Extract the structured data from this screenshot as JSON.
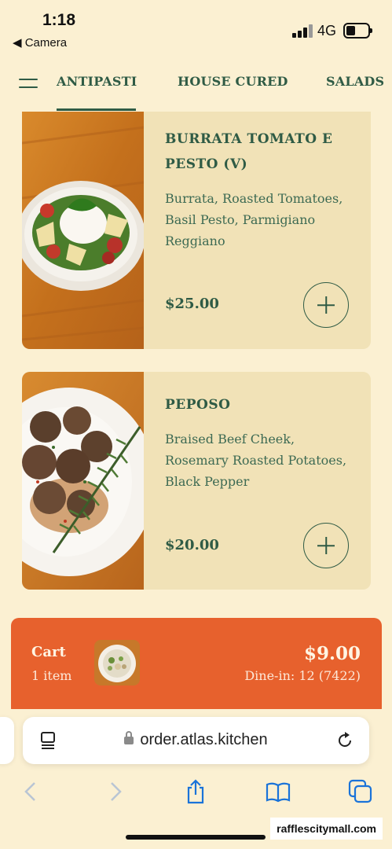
{
  "status_bar": {
    "time": "1:18",
    "back_app": "◀ Camera",
    "network": "4G"
  },
  "nav": {
    "tabs": [
      {
        "label": "ANTIPASTI",
        "active": true
      },
      {
        "label": "HOUSE CURED",
        "active": false
      },
      {
        "label": "SALADS",
        "active": false
      }
    ]
  },
  "menu_items": [
    {
      "name": "BURRATA TOMATO E PESTO (V)",
      "description": "Burrata, Roasted Tomatoes, Basil Pesto, Parmigiano Reggiano",
      "price": "$25.00"
    },
    {
      "name": "PEPOSO",
      "description": "Braised Beef Cheek, Rosemary Roasted Potatoes, Black Pepper",
      "price": "$20.00"
    }
  ],
  "cart": {
    "label": "Cart",
    "item_count": "1 item",
    "total": "$9.00",
    "dine_in": "Dine-in: 12 (7422)"
  },
  "browser": {
    "url": "order.atlas.kitchen"
  },
  "watermark": "rafflescitymall.com",
  "colors": {
    "background": "#fbf0d2",
    "card": "#f1e2b7",
    "accent_green": "#2f5b45",
    "cart_orange": "#e7612d"
  }
}
